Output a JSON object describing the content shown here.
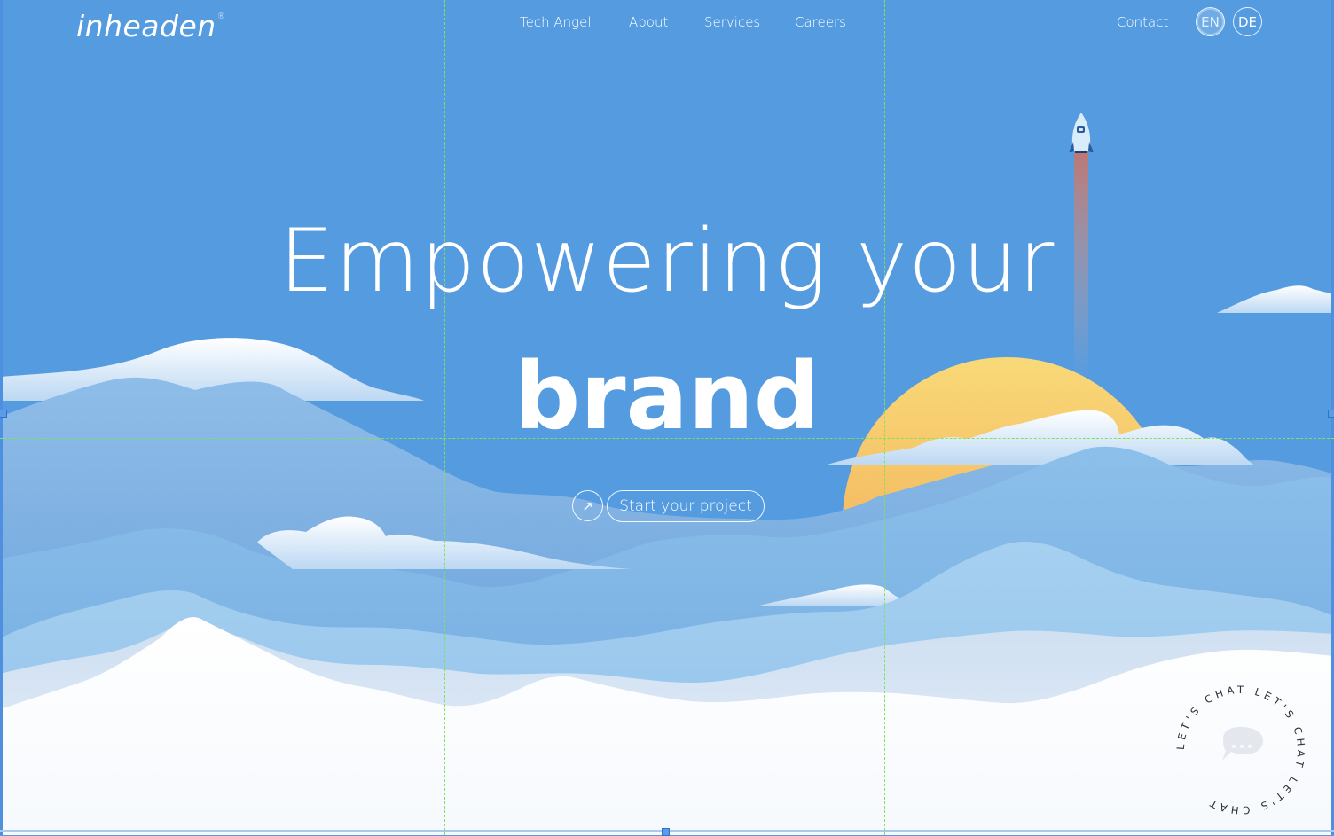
{
  "brand": {
    "logo_text": "inheaden",
    "registered_mark": "®"
  },
  "nav": {
    "links": [
      {
        "label": "Tech Angel"
      },
      {
        "label": "About"
      },
      {
        "label": "Services"
      },
      {
        "label": "Careers"
      }
    ],
    "contact": "Contact",
    "languages": [
      {
        "code": "EN",
        "active": true
      },
      {
        "code": "DE",
        "active": false
      }
    ]
  },
  "hero": {
    "line1": "Empowering your",
    "line2": "brand",
    "cta_label": "Start your project",
    "cta_icon": "arrow-up-right-icon"
  },
  "chat_widget": {
    "ring_text": "LET'S CHAT LET'S CHAT LET'S CHAT ",
    "icon": "chat-bubble-icon"
  },
  "colors": {
    "sky": "#559be0",
    "sun_top": "#f7d876",
    "sun_bottom": "#f3a24e",
    "snow": "#fafcfe",
    "guides": "#7ee35a"
  }
}
